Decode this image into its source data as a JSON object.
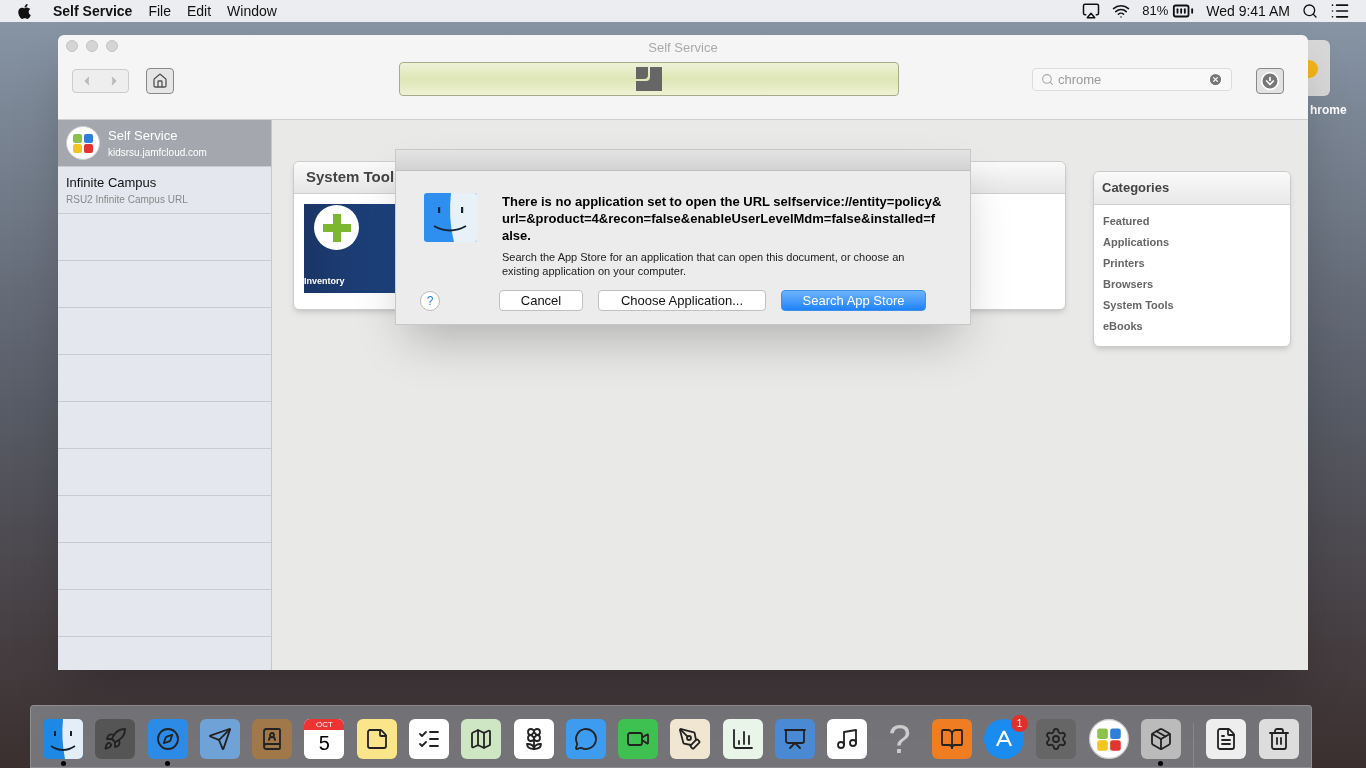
{
  "menu_bar": {
    "app_name": "Self Service",
    "menus": [
      "File",
      "Edit",
      "Window"
    ],
    "battery": "81%",
    "clock": "Wed 9:41 AM"
  },
  "desktop_icon": {
    "label": "hrome"
  },
  "window": {
    "title": "Self Service",
    "search": {
      "value": "chrome"
    },
    "sidebar": {
      "items": [
        {
          "title": "Self Service",
          "subtitle": "kidsrsu.jamfcloud.com",
          "selected": true,
          "kind": "server"
        },
        {
          "title": "Infinite Campus",
          "subtitle": "RSU2 Infinite Campus URL",
          "selected": false,
          "kind": "link"
        }
      ]
    },
    "section": {
      "title": "System Tool",
      "tile_label": "Inventory"
    },
    "categories": {
      "title": "Categories",
      "items": [
        "Featured",
        "Applications",
        "Printers",
        "Browsers",
        "System Tools",
        "eBooks"
      ]
    }
  },
  "dialog": {
    "message": "There is no application set to open the URL selfservice://entity=policy&url=&product=4&recon=false&enableUserLevelMdm=false&installed=false.",
    "detail": "Search the App Store for an application that can open this document, or choose an existing application on your computer.",
    "help": "?",
    "buttons": [
      {
        "label": "Cancel",
        "default": false
      },
      {
        "label": "Choose Application...",
        "default": false
      },
      {
        "label": "Search App Store",
        "default": true
      }
    ]
  },
  "dock": {
    "items": [
      {
        "kind": "finder",
        "running": true
      },
      {
        "kind": "launchpad",
        "running": false
      },
      {
        "kind": "safari",
        "running": true
      },
      {
        "kind": "mail",
        "running": false
      },
      {
        "kind": "contacts",
        "running": false
      },
      {
        "kind": "calendar",
        "running": false,
        "month": "OCT",
        "day": "5"
      },
      {
        "kind": "notes",
        "running": false
      },
      {
        "kind": "reminders",
        "running": false
      },
      {
        "kind": "maps",
        "running": false
      },
      {
        "kind": "photos",
        "running": false
      },
      {
        "kind": "messages",
        "running": false
      },
      {
        "kind": "facetime",
        "running": false
      },
      {
        "kind": "pages",
        "running": false
      },
      {
        "kind": "numbers",
        "running": false
      },
      {
        "kind": "keynote",
        "running": false
      },
      {
        "kind": "music",
        "running": false
      },
      {
        "kind": "help",
        "running": false,
        "glyph": "?"
      },
      {
        "kind": "books",
        "running": false
      },
      {
        "kind": "appstore",
        "running": false,
        "badge": "1"
      },
      {
        "kind": "preferences",
        "running": false
      },
      {
        "kind": "selfservice",
        "running": false
      },
      {
        "kind": "installer",
        "running": true
      },
      {
        "kind": "separator"
      },
      {
        "kind": "document",
        "running": false
      },
      {
        "kind": "trash",
        "running": false
      }
    ]
  }
}
